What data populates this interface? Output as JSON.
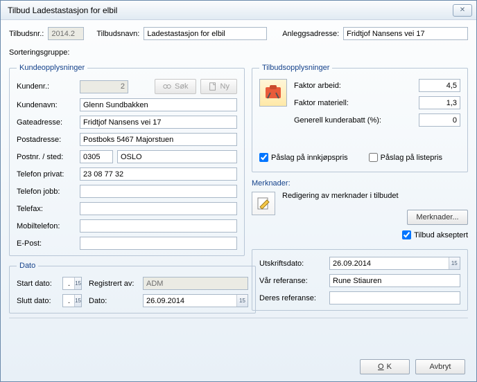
{
  "window": {
    "title": "Tilbud Ladestastasjon for elbil"
  },
  "top": {
    "tilbudsnr_label": "Tilbudsnr.:",
    "tilbudsnr": "2014.2",
    "tilbudsnavn_label": "Tilbudsnavn:",
    "tilbudsnavn": "Ladestastasjon for elbil",
    "anleggsadresse_label": "Anleggsadresse:",
    "anleggsadresse": "Fridtjof Nansens vei 17",
    "sorteringsgruppe_label": "Sorteringsgruppe:"
  },
  "kunde": {
    "legend": "Kundeopplysninger",
    "kundenr_label": "Kundenr.:",
    "kundenr": "2",
    "sok_label": "Søk",
    "ny_label": "Ny",
    "kundenavn_label": "Kundenavn:",
    "kundenavn": "Glenn Sundbakken",
    "gateadresse_label": "Gateadresse:",
    "gateadresse": "Fridtjof Nansens vei 17",
    "postadresse_label": "Postadresse:",
    "postadresse": "Postboks 5467 Majorstuen",
    "postnr_label": "Postnr. / sted:",
    "postnr": "0305",
    "sted": "OSLO",
    "telefonpriv_label": "Telefon privat:",
    "telefonpriv": "23 08 77 32",
    "telefonjobb_label": "Telefon jobb:",
    "telefax_label": "Telefax:",
    "mobil_label": "Mobiltelefon:",
    "epost_label": "E-Post:"
  },
  "dato": {
    "legend": "Dato",
    "start_label": "Start dato:",
    "start": " .  .    ",
    "slutt_label": "Slutt dato:",
    "slutt": " .  .    ",
    "registrert_label": "Registrert av:",
    "registrert": "ADM",
    "dato_label": "Dato:",
    "dato": "26.09.2014"
  },
  "tilbud": {
    "legend": "Tilbudsopplysninger",
    "faktor_arbeid_label": "Faktor arbeid:",
    "faktor_arbeid": "4,5",
    "faktor_materiell_label": "Faktor materiell:",
    "faktor_materiell": "1,3",
    "generell_rabatt_label": "Generell kunderabatt (%):",
    "generell_rabatt": "0",
    "paslag_innkjop": "Påslag på innkjøpspris",
    "paslag_liste": "Påslag på listepris"
  },
  "merknader": {
    "legend": "Merknader:",
    "desc": "Redigering av merknader i tilbudet",
    "btn": "Merknader...",
    "akseptert": "Tilbud akseptert"
  },
  "utskrift": {
    "utskriftsdato_label": "Utskriftsdato:",
    "utskriftsdato": "26.09.2014",
    "var_ref_label": "Vår referanse:",
    "var_ref": "Rune Stiauren",
    "deres_ref_label": "Deres referanse:"
  },
  "buttons": {
    "ok": "OK",
    "avbryt": "Avbryt"
  },
  "icons": {
    "close": "✕",
    "search": "binoculars",
    "new": "document",
    "calendar": "15"
  }
}
